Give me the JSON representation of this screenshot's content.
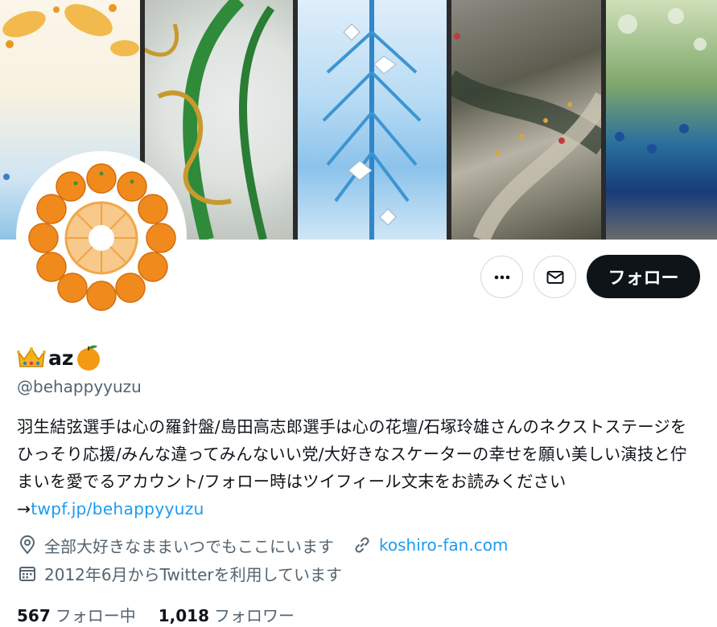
{
  "profile": {
    "display_name": "az",
    "handle": "@behappyyuzu",
    "bio_text": "羽生結弦選手は心の羅針盤/島田高志郎選手は心の花壇/石塚玲雄さんのネクストステージをひっそり応援/みんな違ってみんないい党/大好きなスケーターの幸せを願い美しい演技と佇まいを愛でるアカウント/フォロー時はツイフィール文末をお読みください→",
    "bio_link": "twpf.jp/behappyyuzu",
    "location": "全部大好きなままいつでもここにいます",
    "website": "koshiro-fan.com",
    "joined": "2012年6月からTwitterを利用しています"
  },
  "actions": {
    "more_icon": "more-horizontal-icon",
    "message_icon": "envelope-icon",
    "follow_label": "フォロー"
  },
  "stats": {
    "following_count": "567",
    "following_label": "フォロー中",
    "followers_count": "1,018",
    "followers_label": "フォロワー"
  },
  "colors": {
    "accent": "#1d9bf0",
    "follow_button": "#0f1419",
    "secondary_text": "#536471"
  }
}
